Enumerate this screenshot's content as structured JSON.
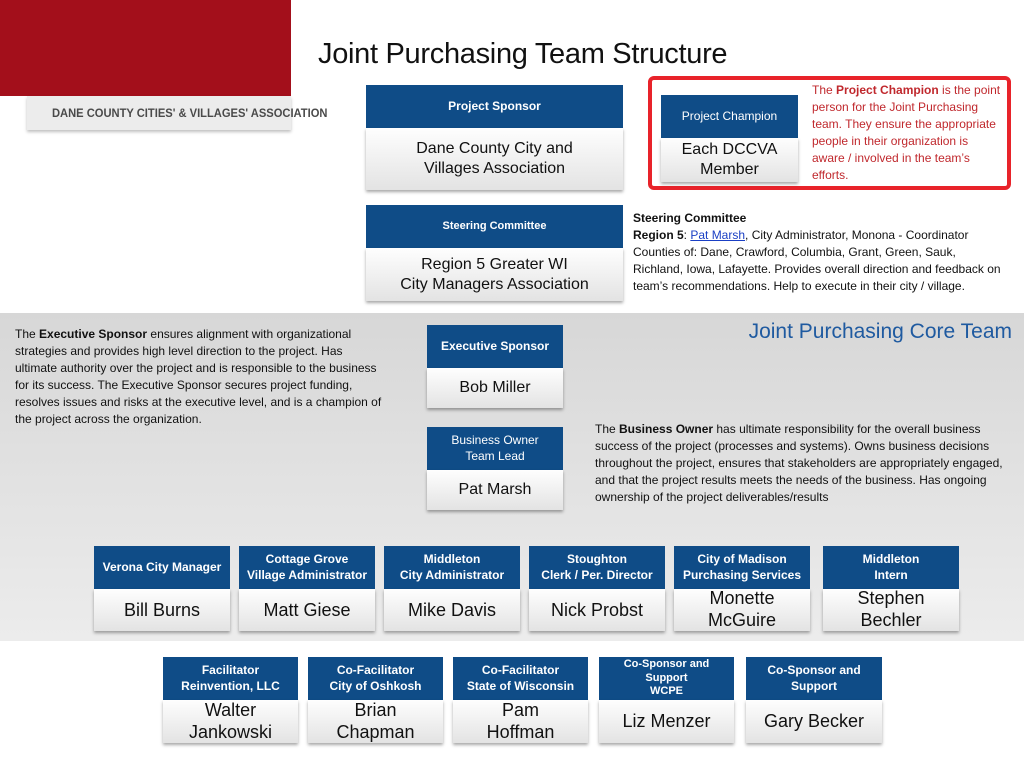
{
  "logo": {
    "text": "DANE COUNTY CITIES' & VILLAGES' ASSOCIATION"
  },
  "title": "Joint Purchasing Team Structure",
  "project_sponsor": {
    "header": "Project Sponsor",
    "body": "Dane County City and\nVillages Association"
  },
  "project_champion": {
    "header": "Project Champion",
    "body": "Each DCCVA\nMember",
    "desc_prefix": "The ",
    "desc_bold": "Project Champion",
    "desc_rest": " is the point person for the Joint Purchasing team.  They ensure the appropriate people in their organization is aware / involved in the team’s efforts."
  },
  "steering": {
    "header": "Steering Committee",
    "body": "Region 5 Greater WI\nCity Managers Association",
    "desc_title": "Steering Committee",
    "desc_region": "Region 5",
    "desc_sep": ": ",
    "desc_link": "Pat Marsh",
    "desc_rest": ", City Administrator, Monona - Coordinator Counties of: Dane, Crawford, Columbia, Grant, Green, Sauk, Richland, Iowa, Lafayette.  Provides overall direction and feedback on team’s recommendations.  Help to execute in their city / village."
  },
  "core_team": {
    "title": "Joint Purchasing Core Team"
  },
  "executive_sponsor": {
    "header": "Executive Sponsor",
    "body": "Bob Miller",
    "desc_prefix": "The ",
    "desc_bold": "Executive Sponsor",
    "desc_rest": " ensures alignment with organizational strategies and provides high level direction to the project.  Has ultimate authority over the project and is responsible to the business for its success.  The Executive Sponsor secures project funding, resolves issues and risks at the executive level, and is a champion of the project across the organization."
  },
  "business_owner": {
    "header": "Business Owner\nTeam Lead",
    "body": "Pat Marsh",
    "desc_prefix": "The ",
    "desc_bold": "Business Owner",
    "desc_rest": " has ultimate responsibility for the overall business success of the project (processes and systems). Owns business decisions throughout the project, ensures that stakeholders are appropriately engaged, and that the project results meets the needs of the business.  Has ongoing ownership of the project deliverables/results"
  },
  "core_members": [
    {
      "header": "Verona City Manager",
      "body": "Bill Burns"
    },
    {
      "header": "Cottage Grove\nVillage Administrator",
      "body": "Matt Giese"
    },
    {
      "header": "Middleton\nCity Administrator",
      "body": "Mike Davis"
    },
    {
      "header": "Stoughton\nClerk / Per. Director",
      "body": "Nick Probst"
    },
    {
      "header": "City of Madison\nPurchasing Services",
      "body": "Monette\nMcGuire"
    },
    {
      "header": "Middleton\nIntern",
      "body": "Stephen\nBechler"
    }
  ],
  "support_members": [
    {
      "header": "Facilitator\nReinvention, LLC",
      "body": "Walter\nJankowski"
    },
    {
      "header": "Co-Facilitator\nCity of Oshkosh",
      "body": "Brian\nChapman"
    },
    {
      "header": "Co-Facilitator\nState of Wisconsin",
      "body": "Pam\nHoffman"
    },
    {
      "header": "Co-Sponsor and\nSupport\nWCPE",
      "body": "Liz Menzer"
    },
    {
      "header": "Co-Sponsor and\nSupport",
      "body": "Gary Becker"
    }
  ]
}
